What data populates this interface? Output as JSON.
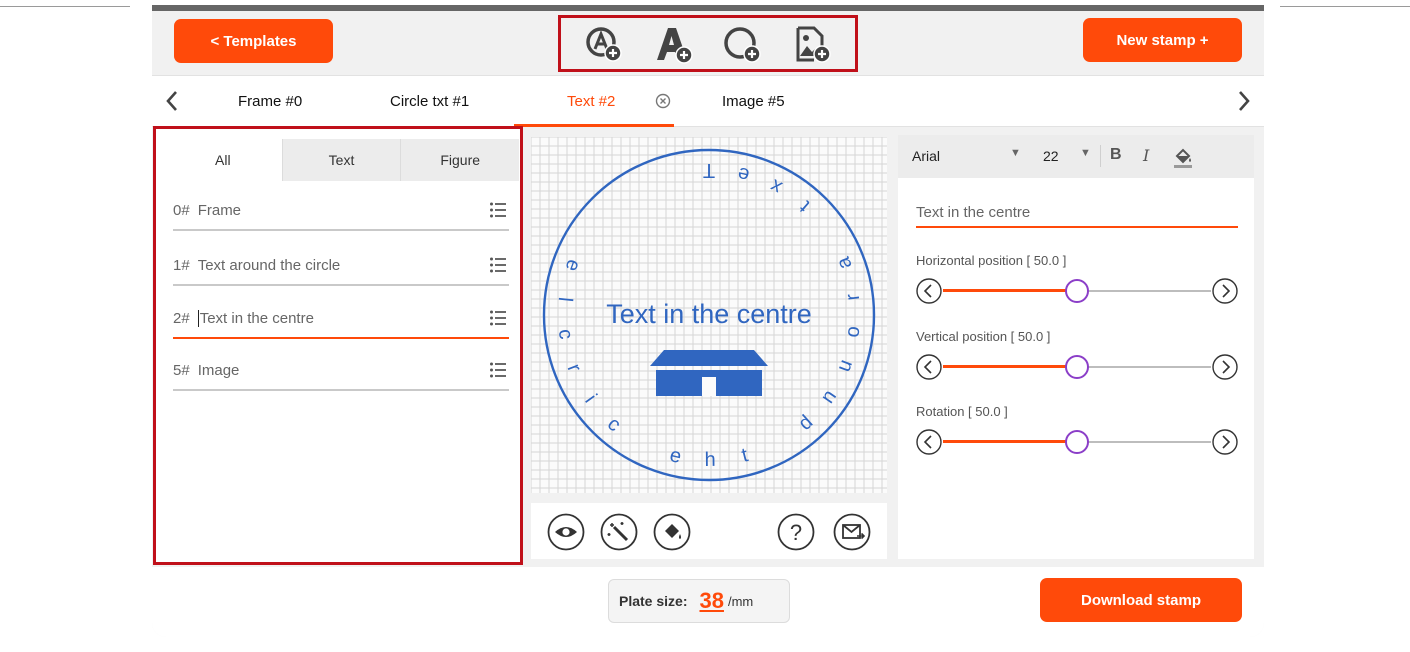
{
  "header": {
    "templates_label": "<  Templates",
    "new_stamp_label": "New stamp +",
    "tools": [
      {
        "icon": "add-circle-text-icon"
      },
      {
        "icon": "add-text-icon"
      },
      {
        "icon": "add-circle-icon"
      },
      {
        "icon": "add-image-icon"
      }
    ]
  },
  "tabs": [
    {
      "label": "Frame #0"
    },
    {
      "label": "Circle txt #1"
    },
    {
      "label": "Text #2",
      "active": true
    },
    {
      "label": "Image #5"
    }
  ],
  "left_panel": {
    "filter_tabs": [
      "All",
      "Text",
      "Figure"
    ],
    "items": [
      {
        "num": "0#",
        "label": "Frame"
      },
      {
        "num": "1#",
        "label": "Text around the circle"
      },
      {
        "num": "2#",
        "label": "Text in the centre",
        "active": true
      },
      {
        "num": "5#",
        "label": "Image"
      }
    ]
  },
  "canvas": {
    "center_text": "Text in the centre",
    "circle_text": "Text around the circle"
  },
  "right_panel": {
    "font": "Arial",
    "size": "22",
    "text_value": "Text in the centre",
    "horizontal_label": "Horizontal position [ 50.0 ]",
    "vertical_label": "Vertical position [ 50.0 ]",
    "rotation_label": "Rotation [ 50.0 ]",
    "horizontal_value": 50,
    "vertical_value": 50,
    "rotation_value": 50
  },
  "footer": {
    "plate_label": "Plate size:",
    "plate_value": "38",
    "plate_unit": "/mm",
    "download_label": "Download stamp"
  },
  "colors": {
    "accent": "#ff4a0a",
    "stamp_blue": "#3066c0",
    "highlight_border": "#c0101a",
    "slider_thumb": "#8b3ec8"
  }
}
